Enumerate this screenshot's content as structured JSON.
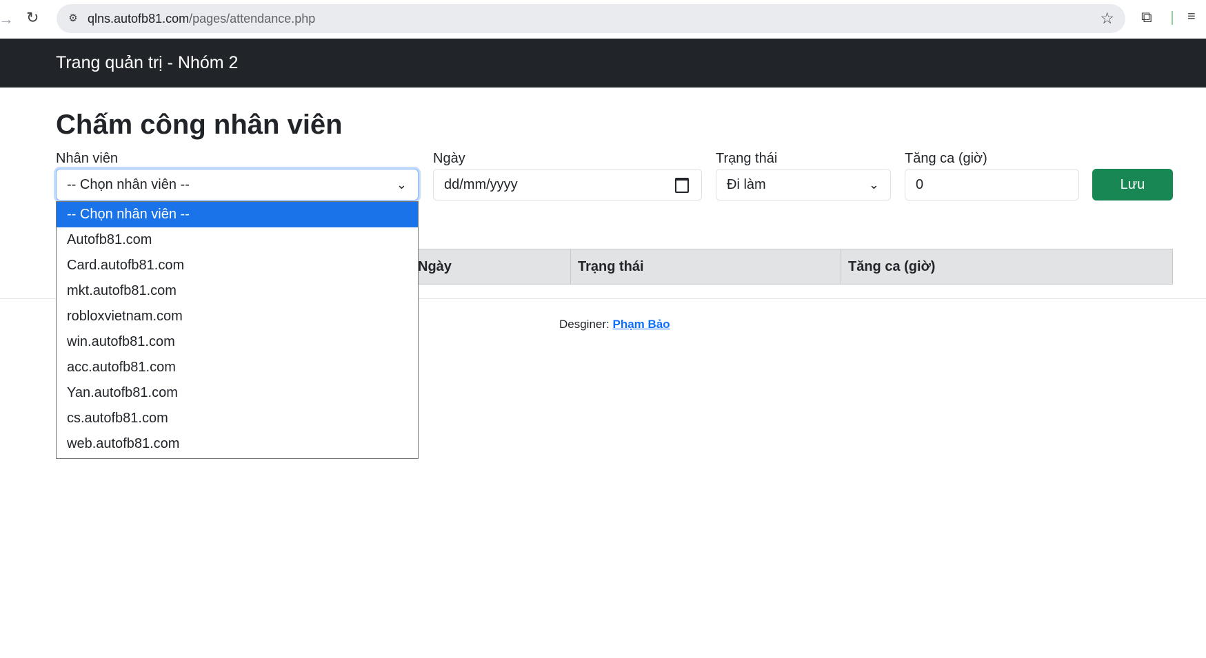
{
  "browser": {
    "url_domain": "qlns.autofb81.com",
    "url_path": "/pages/attendance.php"
  },
  "navbar": {
    "brand": "Trang quản trị - Nhóm 2"
  },
  "page": {
    "title": "Chấm công nhân viên"
  },
  "form": {
    "employee_label": "Nhân viên",
    "employee_value": "-- Chọn nhân viên --",
    "date_label": "Ngày",
    "date_placeholder": "dd/mm/yyyy",
    "status_label": "Trạng thái",
    "status_value": "Đi làm",
    "overtime_label": "Tăng ca (giờ)",
    "overtime_value": "0",
    "save_label": "Lưu"
  },
  "table": {
    "headers": [
      "Ngày",
      "Trạng thái",
      "Tăng ca (giờ)"
    ]
  },
  "footer": {
    "prefix": "Desginer:",
    "link": "Phạm Bảo"
  },
  "dropdown": {
    "options": [
      "-- Chọn nhân viên --",
      "Autofb81.com",
      "Card.autofb81.com",
      "mkt.autofb81.com",
      "robloxvietnam.com",
      "win.autofb81.com",
      "acc.autofb81.com",
      "Yan.autofb81.com",
      "cs.autofb81.com",
      "web.autofb81.com"
    ],
    "selected_index": 0
  },
  "colors": {
    "navbar": "#212529",
    "save": "#198754",
    "selected_option": "#1a73e8",
    "link": "#0d6efd"
  }
}
